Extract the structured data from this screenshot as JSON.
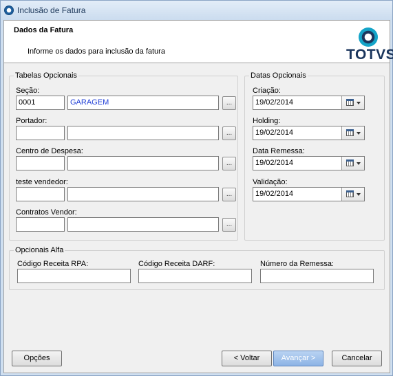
{
  "window": {
    "title": "Inclusão de Fatura"
  },
  "header": {
    "title": "Dados da Fatura",
    "subtitle": "Informe os dados para inclusão da fatura",
    "logo_text": "TOTVS"
  },
  "tabelas": {
    "legend": "Tabelas Opcionais",
    "fields": [
      {
        "label": "Seção:",
        "code": "0001",
        "desc": "GARAGEM",
        "lookup": "..."
      },
      {
        "label": "Portador:",
        "code": "",
        "desc": "",
        "lookup": "..."
      },
      {
        "label": "Centro de Despesa:",
        "code": "",
        "desc": "",
        "lookup": "..."
      },
      {
        "label": "teste vendedor:",
        "code": "",
        "desc": "",
        "lookup": "..."
      },
      {
        "label": "Contratos Vendor:",
        "code": "",
        "desc": "",
        "lookup": "..."
      }
    ]
  },
  "datas": {
    "legend": "Datas Opcionais",
    "fields": [
      {
        "label": "Criação:",
        "value": "19/02/2014"
      },
      {
        "label": "Holding:",
        "value": "19/02/2014"
      },
      {
        "label": "Data Remessa:",
        "value": "19/02/2014"
      },
      {
        "label": "Validação:",
        "value": "19/02/2014"
      }
    ]
  },
  "alfa": {
    "legend": "Opcionais Alfa",
    "fields": [
      {
        "label": "Código Receita RPA:",
        "value": ""
      },
      {
        "label": "Código Receita DARF:",
        "value": ""
      },
      {
        "label": "Número da Remessa:",
        "value": ""
      }
    ]
  },
  "footer": {
    "options_label": "Opções",
    "back_label": "< Voltar",
    "next_label": "Avançar >",
    "cancel_label": "Cancelar"
  },
  "icons": {
    "app": "app-logo-icon",
    "lookup": "ellipsis-lookup-icon",
    "calendar": "calendar-icon",
    "dropdown": "chevron-down-icon"
  },
  "colors": {
    "title_bar": "#cbdcef",
    "primary_button": "#8cb3e5",
    "lookup_value_text": "#1f3ed6",
    "logo_dark": "#1b365d",
    "logo_accent": "#14a4c8"
  }
}
